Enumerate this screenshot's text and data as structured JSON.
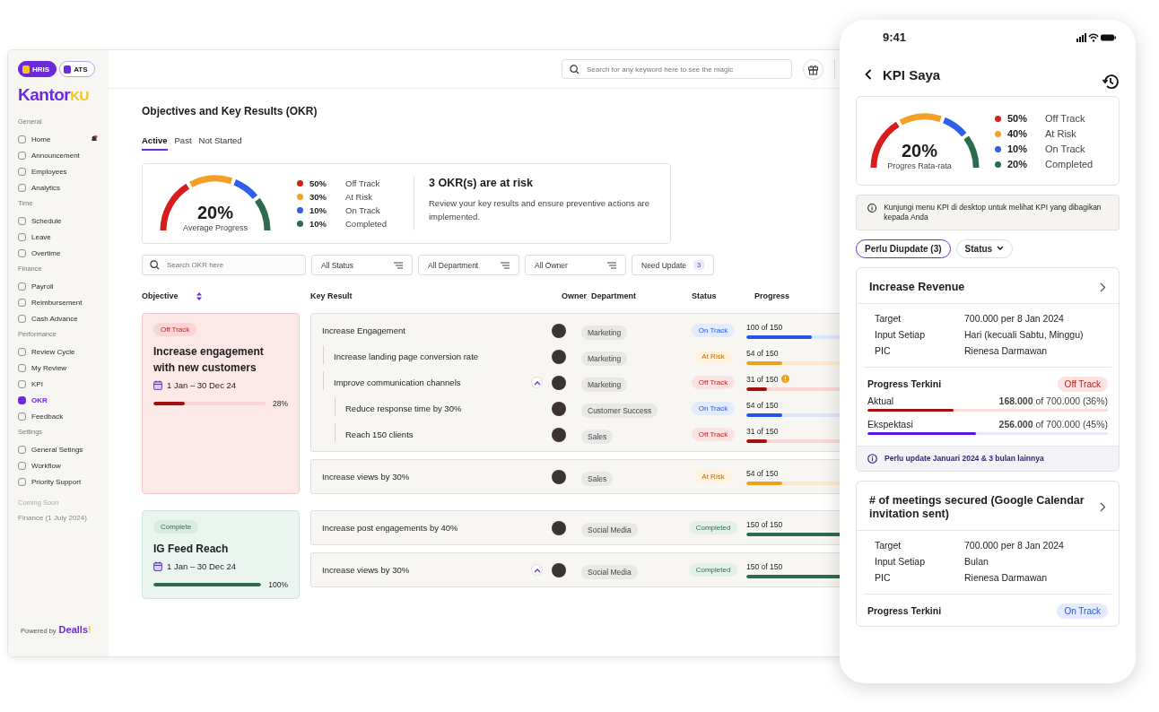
{
  "sidebar": {
    "apps": [
      {
        "label": "HRIS",
        "selected": true
      },
      {
        "label": "ATS",
        "selected": false
      }
    ],
    "logo": {
      "main": "Kantor",
      "accent": "KU"
    },
    "sections": [
      {
        "title": "General",
        "items": [
          {
            "label": "Home",
            "selected": false,
            "notification": true
          },
          {
            "label": "Announcement",
            "selected": false
          },
          {
            "label": "Employees",
            "selected": false
          },
          {
            "label": "Analytics",
            "selected": false
          }
        ]
      },
      {
        "title": "Time",
        "items": [
          {
            "label": "Schedule",
            "selected": false
          },
          {
            "label": "Leave",
            "selected": false
          },
          {
            "label": "Overtime",
            "selected": false
          }
        ]
      },
      {
        "title": "Finance",
        "items": [
          {
            "label": "Payroll",
            "selected": false
          },
          {
            "label": "Reimbursement",
            "selected": false
          },
          {
            "label": "Cash Advance",
            "selected": false
          }
        ]
      },
      {
        "title": "Performance",
        "items": [
          {
            "label": "Review Cycle",
            "selected": false
          },
          {
            "label": "My Review",
            "selected": false
          },
          {
            "label": "KPI",
            "selected": false
          },
          {
            "label": "OKR",
            "selected": true
          },
          {
            "label": "Feedback",
            "selected": false
          }
        ]
      },
      {
        "title": "Settings",
        "items": [
          {
            "label": "General Setings",
            "selected": false
          },
          {
            "label": "Workflow",
            "selected": false
          },
          {
            "label": "Priority Support",
            "selected": false
          }
        ]
      }
    ],
    "coming_soon": {
      "title": "Coming Soon",
      "items": [
        "Finance (1 July 2024)"
      ]
    },
    "footer": {
      "prefix": "Powered by",
      "brand": "Dealls",
      "brand_mark": "!"
    }
  },
  "topbar": {
    "search": {
      "placeholder": "Search for any keyword here to see the magic"
    }
  },
  "page": {
    "title": "Objectives and Key Results (OKR)",
    "tabs": [
      {
        "label": "Active",
        "selected": true
      },
      {
        "label": "Past",
        "selected": false
      },
      {
        "label": "Not Started",
        "selected": false
      }
    ],
    "summary": {
      "value": "20%",
      "label": "Average Progress",
      "legend": [
        {
          "value": "50%",
          "label": "Off Track",
          "color": "#d91c1c"
        },
        {
          "value": "30%",
          "label": "At Risk",
          "color": "#f2a124"
        },
        {
          "value": "10%",
          "label": "On Track",
          "color": "#2f5ee8"
        },
        {
          "value": "10%",
          "label": "Completed",
          "color": "#2d6a4f"
        }
      ],
      "risk_title": "3 OKR(s) are at risk",
      "risk_text": "Review your key results and ensure preventive actions are implemented."
    },
    "filters": {
      "search": {
        "placeholder": "Search OKR here"
      },
      "dropdowns": [
        "All Status",
        "All Department",
        "All Owner"
      ],
      "need_update": {
        "label": "Need Update",
        "count": "3"
      }
    },
    "columns": [
      "Objective",
      "Key Result",
      "Owner",
      "Department",
      "Status",
      "Progress"
    ],
    "objectives": [
      {
        "status": {
          "label": "Off Track",
          "kind": "off_track"
        },
        "title": "Increase engagement with new customers",
        "date": "1 Jan – 30 Dec 24",
        "level": 0.28,
        "percent": "28%",
        "groups": [
          {
            "rows": [
              {
                "label": "Increase Engagement",
                "department": "Marketing",
                "status": {
                  "label": "On Track",
                  "kind": "on_track"
                },
                "progress": "100 of 150",
                "level": 0.667,
                "children": [
                  {
                    "label": "Increase landing page conversion rate",
                    "department": "Marketing",
                    "status": {
                      "label": "At Risk",
                      "kind": "at_risk"
                    },
                    "progress": "54 of 150",
                    "level": 0.36
                  },
                  {
                    "label": "Improve communication channels",
                    "expanded": true,
                    "department": "Marketing",
                    "status": {
                      "label": "Off Track",
                      "kind": "off_track"
                    },
                    "progress": "31 of 150",
                    "warning": true,
                    "level": 0.207,
                    "children": [
                      {
                        "label": "Reduce response time by 30%",
                        "department": "Customer Success",
                        "status": {
                          "label": "On Track",
                          "kind": "on_track"
                        },
                        "progress": "54 of 150",
                        "level": 0.36
                      },
                      {
                        "label": "Reach 150 clients",
                        "department": "Sales",
                        "status": {
                          "label": "Off Track",
                          "kind": "off_track"
                        },
                        "progress": "31 of 150",
                        "level": 0.207
                      }
                    ]
                  }
                ]
              }
            ]
          },
          {
            "rows": [
              {
                "label": "Increase views by 30%",
                "department": "Sales",
                "status": {
                  "label": "At Risk",
                  "kind": "at_risk"
                },
                "progress": "54 of 150",
                "level": 0.36
              }
            ]
          }
        ]
      },
      {
        "status": {
          "label": "Complete",
          "kind": "completed"
        },
        "title": "IG Feed Reach",
        "date": "1 Jan – 30 Dec 24",
        "level": 1,
        "percent": "100%",
        "groups": [
          {
            "rows": [
              {
                "label": "Increase post engagements by 40%",
                "department": "Social Media",
                "status": {
                  "label": "Completed",
                  "kind": "completed"
                },
                "progress": "150 of 150",
                "level": 1
              }
            ]
          },
          {
            "rows": [
              {
                "label": "Increase views by 30%",
                "expanded": true,
                "department": "Social Media",
                "status": {
                  "label": "Completed",
                  "kind": "completed"
                },
                "progress": "150 of 150",
                "level": 1
              }
            ]
          }
        ]
      }
    ]
  },
  "phone": {
    "time": "9:41",
    "title": "KPI Saya",
    "summary": {
      "value": "20%",
      "label": "Progres Rata-rata",
      "legend": [
        {
          "value": "50%",
          "label": "Off Track",
          "color": "#d91c1c"
        },
        {
          "value": "40%",
          "label": "At Risk",
          "color": "#f2a124"
        },
        {
          "value": "10%",
          "label": "On Track",
          "color": "#2f5ee8"
        },
        {
          "value": "20%",
          "label": "Completed",
          "color": "#2d6a4f"
        }
      ]
    },
    "info": "Kunjungi menu KPI di desktop untuk melihat KPI yang dibagikan kepada Anda",
    "chips": [
      {
        "label": "Perlu Diupdate (3)",
        "selected": true
      },
      {
        "label": "Status",
        "selected": false
      }
    ],
    "cards": [
      {
        "title": "Increase Revenue",
        "fields": [
          {
            "label": "Target",
            "value": "700.000 per 8 Jan 2024"
          },
          {
            "label": "Input Setiap",
            "value": "Hari (kecuali Sabtu, Minggu)"
          },
          {
            "label": "PIC",
            "value": "Rienesa Darmawan"
          }
        ],
        "progress_title": "Progress Terkini",
        "status": {
          "label": "Off Track",
          "kind": "off_track"
        },
        "bars": [
          {
            "label": "Aktual",
            "reading": "**168.000** of 700.000 (36%)",
            "level": 0.36,
            "kind": "actual"
          },
          {
            "label": "Ekspektasi",
            "reading": "**256.000** of 700.000 (45%)",
            "level": 0.45,
            "kind": "expected"
          }
        ],
        "note": "Perlu update Januari 2024 & 3 bulan lainnya"
      },
      {
        "title": "# of meetings secured (Google Calendar invitation sent)",
        "fields": [
          {
            "label": "Target",
            "value": "700.000 per 8 Jan 2024"
          },
          {
            "label": "Input Setiap",
            "value": "Bulan"
          },
          {
            "label": "PIC",
            "value": "Rienesa Darmawan"
          }
        ],
        "progress_title": "Progress Terkini",
        "status": {
          "label": "On Track",
          "kind": "on_track"
        }
      }
    ]
  }
}
